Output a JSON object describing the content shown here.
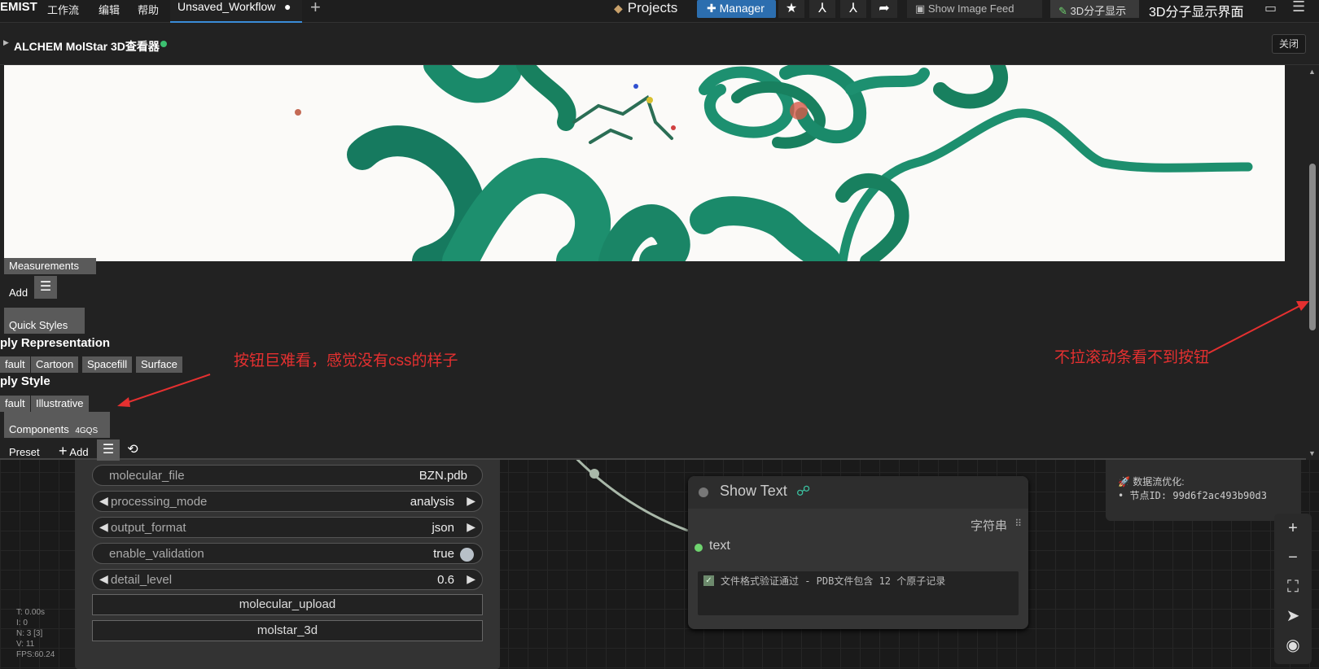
{
  "topbar": {
    "logo": "EMIST",
    "menu": [
      "工作流",
      "编辑",
      "帮助"
    ],
    "tab_title": "Unsaved_Workflow",
    "tab_dirty": "●",
    "new_tab": "+",
    "projects": "Projects",
    "manager": "Manager",
    "show_image_feed": "Show Image Feed",
    "molecule_display": "3D分子显示",
    "molecule_display_title": "3D分子显示界面"
  },
  "dialog": {
    "title": "ALCHEM MolStar 3D查看器",
    "close": "关闭"
  },
  "molstar_controls": {
    "measurements": "Measurements",
    "add": "Add",
    "quick_styles": "Quick Styles",
    "apply_representation": "ply Representation",
    "rep_buttons": [
      "fault",
      "Cartoon",
      "Spacefill",
      "Surface"
    ],
    "apply_style": "ply Style",
    "style_buttons": [
      "fault",
      "Illustrative"
    ],
    "components": "Components",
    "components_id": "4GQS",
    "preset": "Preset",
    "add2": "Add"
  },
  "annotations": {
    "buttons_ugly": "按钮巨难看，感觉没有css的样子",
    "scroll_needed": "不拉滚动条看不到按钮"
  },
  "node_left": {
    "widgets": [
      {
        "label": "molecular_file",
        "value": "BZN.pdb"
      },
      {
        "label": "processing_mode",
        "value": "analysis"
      },
      {
        "label": "output_format",
        "value": "json"
      },
      {
        "label": "enable_validation",
        "value": "true"
      },
      {
        "label": "detail_level",
        "value": "0.6"
      }
    ],
    "buttons": [
      "molecular_upload",
      "molstar_3d"
    ]
  },
  "node_show_text": {
    "title": "Show Text",
    "output_label": "字符串",
    "input_label": "text",
    "content": "文件格式验证通过 - PDB文件包含 12 个原子记录"
  },
  "node_right": {
    "line1": "🚀 数据流优化:",
    "line2": "• 节点ID: 99d6f2ac493b90d3"
  },
  "stats": {
    "t": "T: 0.00s",
    "i": "I: 0",
    "n": "N: 3 [3]",
    "v": "V: 11",
    "fps": "FPS:60.24"
  },
  "colors": {
    "accent_blue": "#2c6eaf",
    "protein_green": "#1f8a6e",
    "annotation_red": "#e53030",
    "status_green": "#3cc070"
  }
}
